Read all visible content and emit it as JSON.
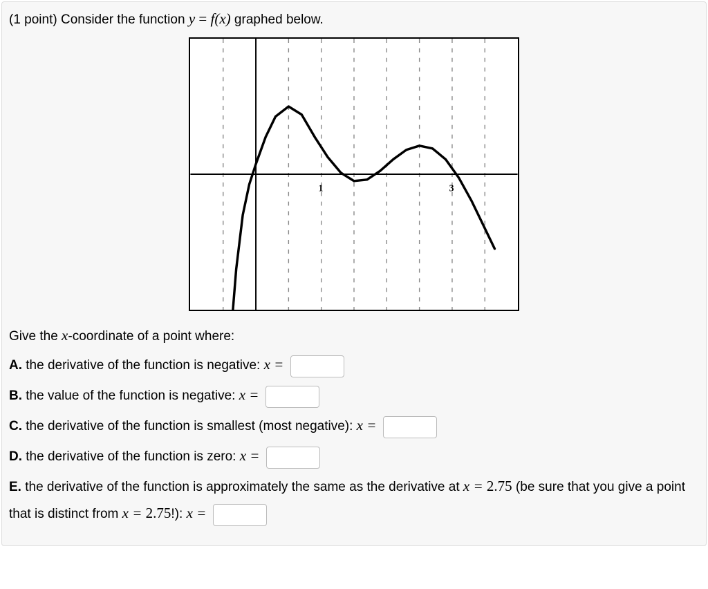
{
  "problem": {
    "points_label": "(1 point) ",
    "prompt_prefix": "Consider the function ",
    "y_var": "y",
    "eq": " = ",
    "fx": "f(x)",
    "prompt_suffix": " graphed below."
  },
  "chart_data": {
    "type": "line",
    "xlim": [
      -1,
      4
    ],
    "ylim": [
      -2,
      2
    ],
    "tick_labels_x": [
      1,
      3
    ],
    "gridlines_x": [
      -1,
      -0.5,
      0,
      0.5,
      1,
      1.5,
      2,
      2.5,
      3,
      3.5,
      4
    ],
    "gridlines_y": [
      -2,
      -1.5,
      -1,
      -0.5,
      0,
      0.5,
      1,
      1.5,
      2
    ],
    "series": [
      {
        "name": "f(x)",
        "points": [
          {
            "x": -0.35,
            "y": -2.0
          },
          {
            "x": -0.3,
            "y": -1.4
          },
          {
            "x": -0.2,
            "y": -0.6
          },
          {
            "x": -0.1,
            "y": -0.15
          },
          {
            "x": 0.0,
            "y": 0.15
          },
          {
            "x": 0.15,
            "y": 0.55
          },
          {
            "x": 0.3,
            "y": 0.85
          },
          {
            "x": 0.5,
            "y": 1.0
          },
          {
            "x": 0.7,
            "y": 0.88
          },
          {
            "x": 0.9,
            "y": 0.55
          },
          {
            "x": 1.1,
            "y": 0.25
          },
          {
            "x": 1.3,
            "y": 0.02
          },
          {
            "x": 1.5,
            "y": -0.1
          },
          {
            "x": 1.7,
            "y": -0.08
          },
          {
            "x": 1.9,
            "y": 0.05
          },
          {
            "x": 2.1,
            "y": 0.22
          },
          {
            "x": 2.3,
            "y": 0.36
          },
          {
            "x": 2.5,
            "y": 0.42
          },
          {
            "x": 2.7,
            "y": 0.38
          },
          {
            "x": 2.9,
            "y": 0.22
          },
          {
            "x": 3.1,
            "y": -0.05
          },
          {
            "x": 3.3,
            "y": -0.4
          },
          {
            "x": 3.5,
            "y": -0.8
          },
          {
            "x": 3.65,
            "y": -1.1
          }
        ]
      }
    ]
  },
  "subprompt": {
    "text_prefix": "Give the ",
    "xvar": "x",
    "text_suffix": "-coordinate of a point where:"
  },
  "questions": {
    "A": {
      "label": "A.",
      "text": " the derivative of the function is negative: ",
      "xeq": "x ="
    },
    "B": {
      "label": "B.",
      "text": " the value of the function is negative: ",
      "xeq": "x ="
    },
    "C": {
      "label": "C.",
      "text": " the derivative of the function is smallest (most negative): ",
      "xeq": "x ="
    },
    "D": {
      "label": "D.",
      "text": " the derivative of the function is zero: ",
      "xeq": "x ="
    },
    "E": {
      "label": "E.",
      "text_prefix": " the derivative of the function is approximately the same as the derivative at ",
      "xeq1": "x = ",
      "val1": "2.75",
      "paren": " (be sure that you give a point that is distinct from ",
      "xeq2": "x = ",
      "val2": "2.75",
      "bang": "!): ",
      "xeq3": "x ="
    }
  },
  "tick_label_1": "1",
  "tick_label_3": "3"
}
